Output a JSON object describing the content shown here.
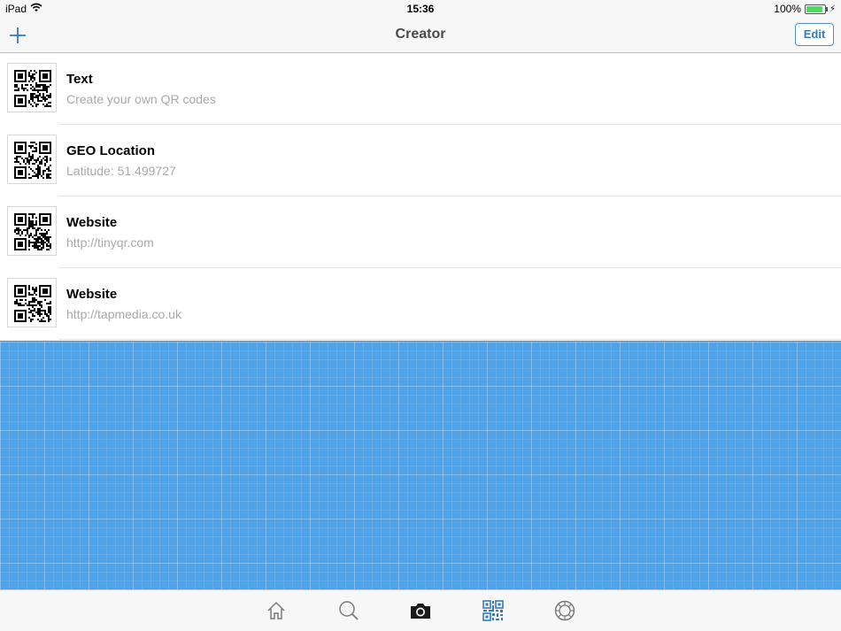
{
  "status": {
    "device": "iPad",
    "time": "15:36",
    "battery": "100%"
  },
  "nav": {
    "title": "Creator",
    "edit_label": "Edit"
  },
  "items": [
    {
      "title": "Text",
      "subtitle": "Create your own QR codes"
    },
    {
      "title": "GEO Location",
      "subtitle": "Latitude: 51.499727"
    },
    {
      "title": "Website",
      "subtitle": "http://tinyqr.com"
    },
    {
      "title": "Website",
      "subtitle": "http://tapmedia.co.uk"
    }
  ],
  "tabs": [
    {
      "icon": "home-icon",
      "selected": false
    },
    {
      "icon": "search-icon",
      "selected": false
    },
    {
      "icon": "camera-icon",
      "selected": false
    },
    {
      "icon": "qr-code-icon",
      "selected": true
    },
    {
      "icon": "settings-gear-icon",
      "selected": false
    }
  ],
  "colors": {
    "accent": "#3478c6",
    "blueprint": "#4fa3e8",
    "subtitle": "#a9a9a9"
  }
}
